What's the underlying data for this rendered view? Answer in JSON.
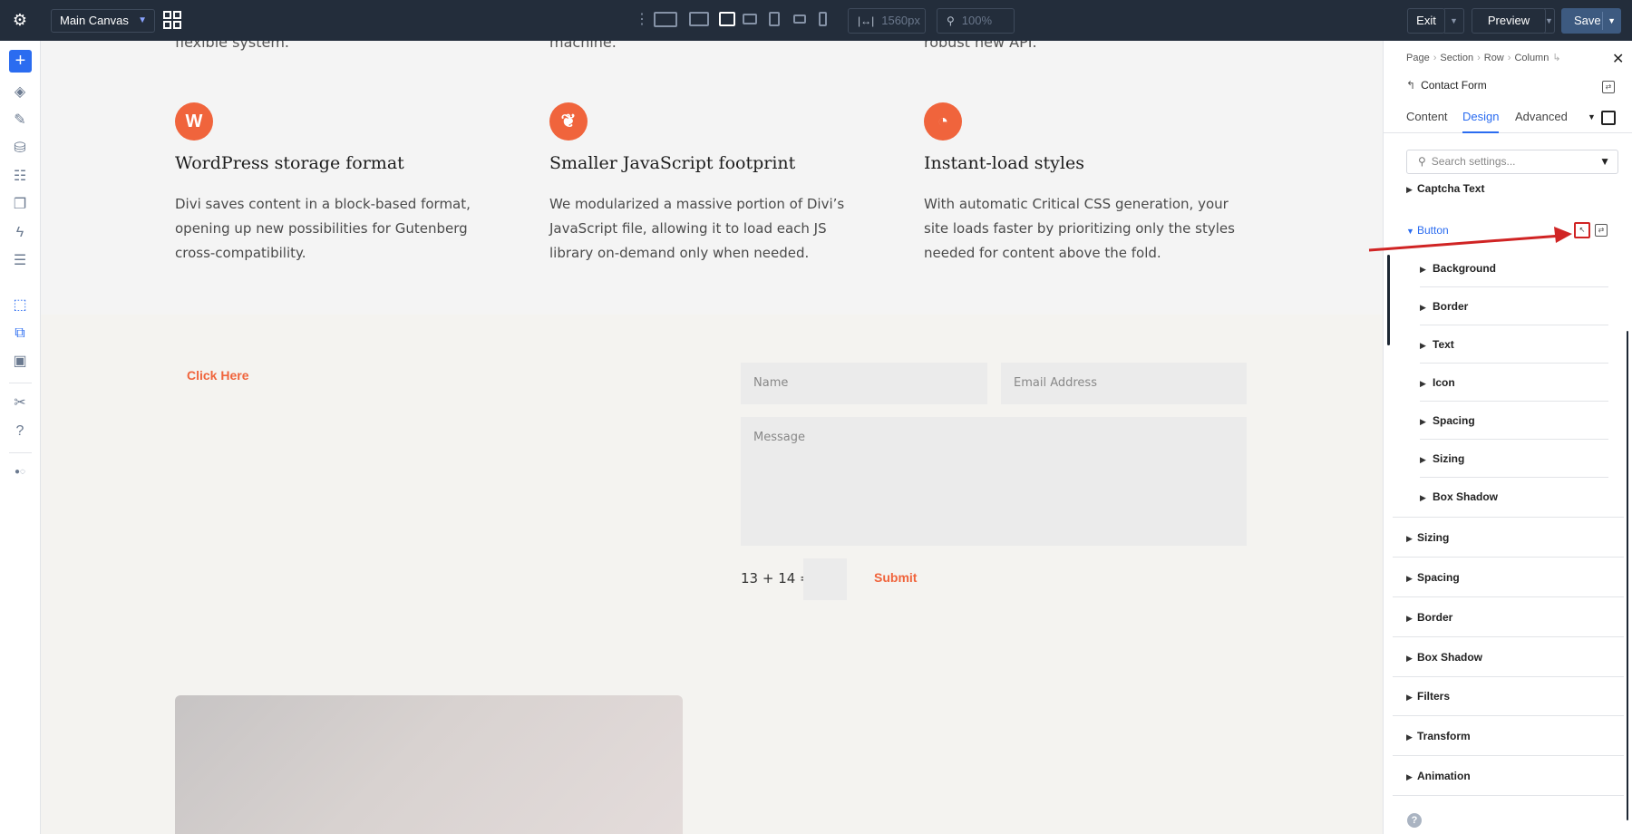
{
  "topbar": {
    "canvas_label": "Main Canvas",
    "width_value": "1560px",
    "zoom_value": "100%",
    "exit_label": "Exit",
    "preview_label": "Preview",
    "save_label": "Save"
  },
  "canvas": {
    "cut_texts": [
      "flexible system.",
      "machine.",
      "robust new API."
    ],
    "features": [
      {
        "icon": "wordpress-icon",
        "title": "WordPress storage format",
        "body": "Divi saves content in a block-based format, opening up new possibilities for Gutenberg cross-compatibility."
      },
      {
        "icon": "feather-icon",
        "title": "Smaller JavaScript footprint",
        "body": "We modularized a massive portion of Divi’s JavaScript file, allowing it to load each JS library on-demand only when needed."
      },
      {
        "icon": "speedometer-icon",
        "title": "Instant-load styles",
        "body": "With automatic Critical CSS generation, your site loads faster by prioritizing only the styles needed for content above the fold."
      }
    ],
    "click_here": "Click Here",
    "form": {
      "name_placeholder": "Name",
      "email_placeholder": "Email Address",
      "message_placeholder": "Message",
      "captcha": "13 + 14 =",
      "submit": "Submit"
    }
  },
  "panel": {
    "breadcrumb": [
      "Page",
      "Section",
      "Row",
      "Column"
    ],
    "module_title": "Contact Form",
    "tabs": [
      "Content",
      "Design",
      "Advanced"
    ],
    "active_tab": "Design",
    "search_placeholder": "Search settings...",
    "captcha_group": "Captcha Text",
    "button_group": "Button",
    "button_sub": [
      "Background",
      "Border",
      "Text",
      "Icon",
      "Spacing",
      "Sizing",
      "Box Shadow"
    ],
    "groups": [
      "Sizing",
      "Spacing",
      "Border",
      "Box Shadow",
      "Filters",
      "Transform",
      "Animation"
    ]
  },
  "colors": {
    "accent": "#f0643c",
    "topbar": "#232d3b",
    "blue": "#2b6cf0",
    "annotation": "#d02424"
  }
}
